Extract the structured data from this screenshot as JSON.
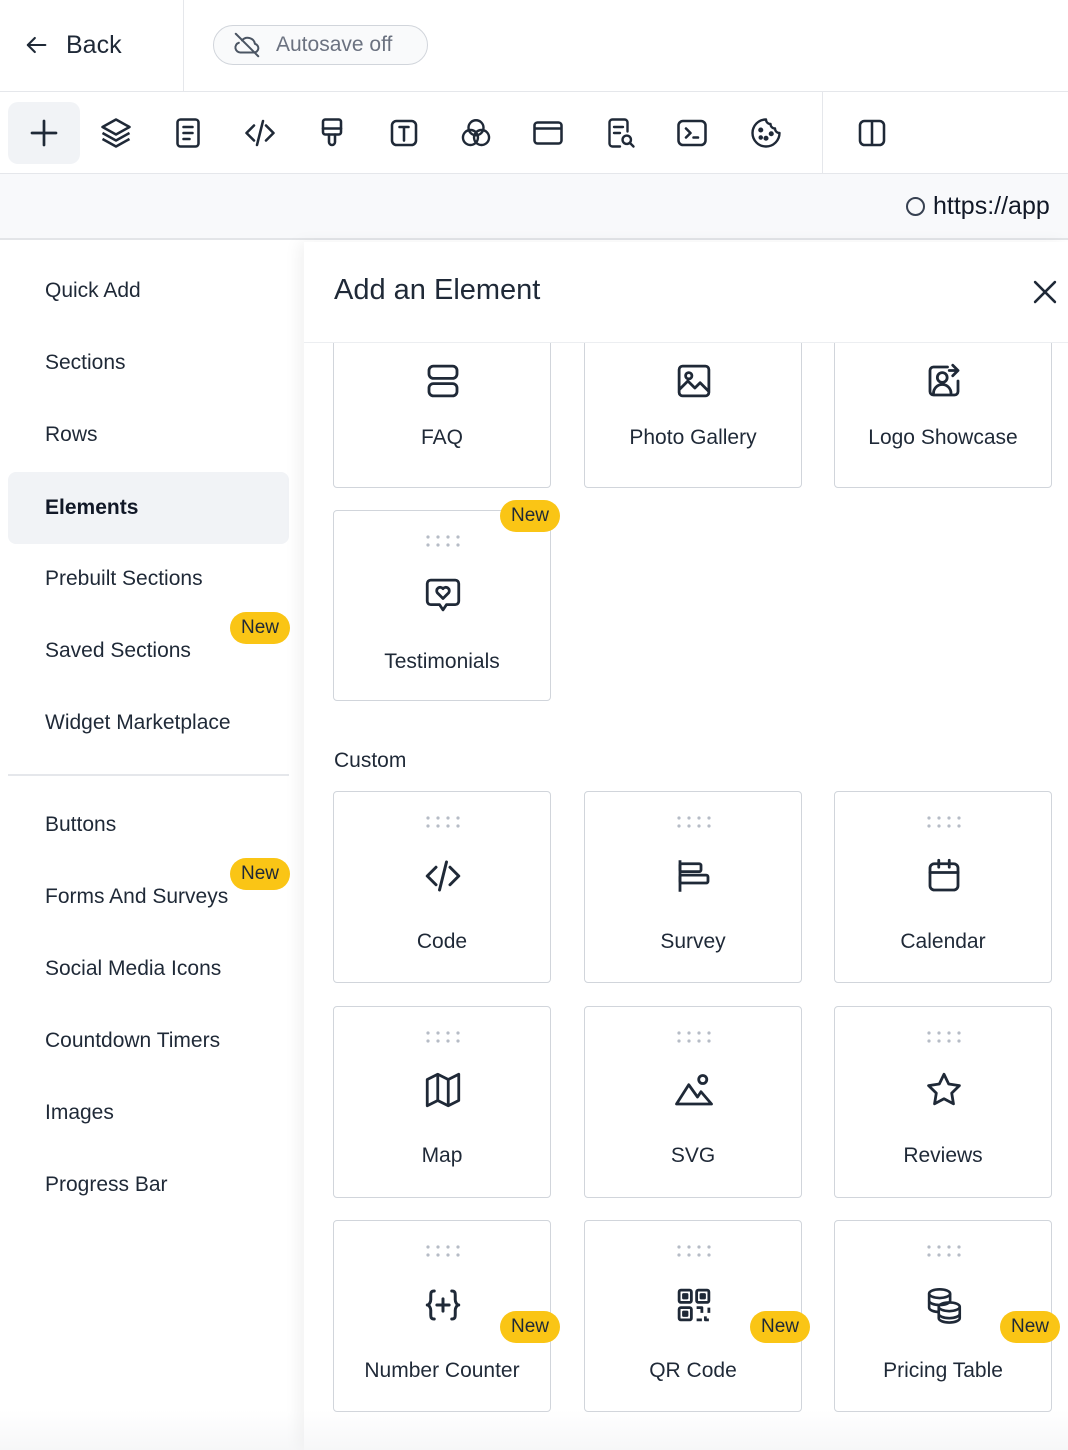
{
  "header": {
    "back_label": "Back",
    "autosave_label": "Autosave off",
    "url_text": "https://app"
  },
  "toolbar": {
    "tools": [
      {
        "name": "add-icon",
        "active": true
      },
      {
        "name": "layers-icon"
      },
      {
        "name": "page-icon"
      },
      {
        "name": "code-icon"
      },
      {
        "name": "paint-brush-icon"
      },
      {
        "name": "typography-icon"
      },
      {
        "name": "colors-icon"
      },
      {
        "name": "browser-window-icon"
      },
      {
        "name": "seo-search-icon"
      },
      {
        "name": "terminal-icon"
      },
      {
        "name": "cookie-icon"
      },
      {
        "name": "split-view-icon"
      }
    ]
  },
  "sidebar": {
    "items": [
      {
        "label": "Quick Add"
      },
      {
        "label": "Sections"
      },
      {
        "label": "Rows"
      },
      {
        "label": "Elements",
        "active": true
      },
      {
        "label": "Prebuilt Sections"
      },
      {
        "label": "Saved Sections",
        "badge": "New"
      },
      {
        "label": "Widget Marketplace"
      },
      {
        "label": "Buttons"
      },
      {
        "label": "Forms And Surveys",
        "badge": "New"
      },
      {
        "label": "Social Media Icons"
      },
      {
        "label": "Countdown Timers"
      },
      {
        "label": "Images"
      },
      {
        "label": "Progress Bar"
      }
    ]
  },
  "panel": {
    "title": "Add an Element",
    "top_cards": [
      {
        "label": "FAQ",
        "icon": "faq-icon"
      },
      {
        "label": "Photo Gallery",
        "icon": "photo-gallery-icon"
      },
      {
        "label": "Logo Showcase",
        "icon": "logo-showcase-icon"
      },
      {
        "label": "Testimonials",
        "icon": "testimonials-icon",
        "badge": "New"
      }
    ],
    "custom_section_label": "Custom",
    "custom_cards": [
      {
        "label": "Code",
        "icon": "code-icon"
      },
      {
        "label": "Survey",
        "icon": "survey-icon"
      },
      {
        "label": "Calendar",
        "icon": "calendar-icon"
      },
      {
        "label": "Map",
        "icon": "map-icon"
      },
      {
        "label": "SVG",
        "icon": "svg-mountain-icon"
      },
      {
        "label": "Reviews",
        "icon": "star-icon"
      },
      {
        "label": "Number Counter",
        "icon": "number-counter-icon",
        "badge": "New"
      },
      {
        "label": "QR Code",
        "icon": "qr-code-icon",
        "badge": "New"
      },
      {
        "label": "Pricing Table",
        "icon": "pricing-table-icon",
        "badge": "New"
      }
    ]
  },
  "colors": {
    "badge": "#fac515",
    "active_bg": "#f1f3f6",
    "icon_stroke": "#1f2937"
  }
}
